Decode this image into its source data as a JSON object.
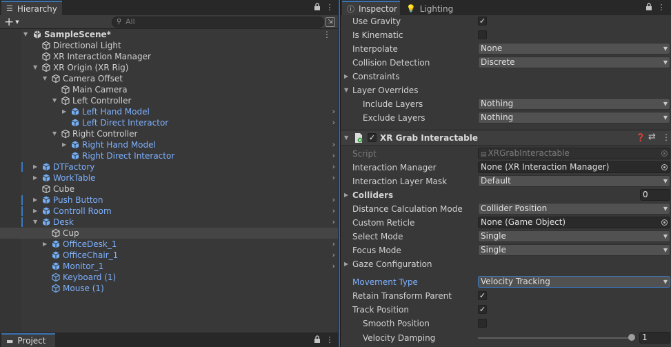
{
  "hierarchy": {
    "tab_label": "Hierarchy",
    "search_placeholder": "All",
    "scene_name": "SampleScene*",
    "items": [
      {
        "label": "Directional Light"
      },
      {
        "label": "XR Interaction Manager"
      },
      {
        "label": "XR Origin (XR Rig)"
      },
      {
        "label": "Camera Offset"
      },
      {
        "label": "Main Camera"
      },
      {
        "label": "Left Controller"
      },
      {
        "label": "Left Hand Model"
      },
      {
        "label": "Left Direct Interactor"
      },
      {
        "label": "Right Controller"
      },
      {
        "label": "Right Hand Model"
      },
      {
        "label": "Right Direct Interactor"
      },
      {
        "label": "DTFactory"
      },
      {
        "label": "WorkTable"
      },
      {
        "label": "Cube"
      },
      {
        "label": "Push Button"
      },
      {
        "label": "Controll Room"
      },
      {
        "label": "Desk"
      },
      {
        "label": "Cup"
      },
      {
        "label": "OfficeDesk_1"
      },
      {
        "label": "OfficeChair_1"
      },
      {
        "label": "Monitor_1"
      },
      {
        "label": "Keyboard (1)"
      },
      {
        "label": "Mouse (1)"
      }
    ]
  },
  "project": {
    "tab_label": "Project"
  },
  "inspector": {
    "tabs": [
      {
        "label": "Inspector"
      },
      {
        "label": "Lighting"
      }
    ],
    "rigidbody": {
      "use_gravity": {
        "label": "Use Gravity",
        "checked": true
      },
      "is_kinematic": {
        "label": "Is Kinematic",
        "checked": false
      },
      "interpolate": {
        "label": "Interpolate",
        "value": "None"
      },
      "collision_detection": {
        "label": "Collision Detection",
        "value": "Discrete"
      },
      "constraints": {
        "label": "Constraints"
      },
      "layer_overrides": {
        "label": "Layer Overrides"
      },
      "include_layers": {
        "label": "Include Layers",
        "value": "Nothing"
      },
      "exclude_layers": {
        "label": "Exclude Layers",
        "value": "Nothing"
      }
    },
    "grab": {
      "title": "XR Grab Interactable",
      "enabled": true,
      "script": {
        "label": "Script",
        "value": "XRGrabInteractable"
      },
      "interaction_manager": {
        "label": "Interaction Manager",
        "value": "None (XR Interaction Manager)"
      },
      "interaction_layer_mask": {
        "label": "Interaction Layer Mask",
        "value": "Default"
      },
      "colliders": {
        "label": "Colliders",
        "value": "0"
      },
      "distance_calc": {
        "label": "Distance Calculation Mode",
        "value": "Collider Position"
      },
      "custom_reticle": {
        "label": "Custom Reticle",
        "value": "None (Game Object)"
      },
      "select_mode": {
        "label": "Select Mode",
        "value": "Single"
      },
      "focus_mode": {
        "label": "Focus Mode",
        "value": "Single"
      },
      "gaze_config": {
        "label": "Gaze Configuration"
      },
      "movement_type": {
        "label": "Movement Type",
        "value": "Velocity Tracking"
      },
      "retain_transform_parent": {
        "label": "Retain Transform Parent",
        "checked": true
      },
      "track_position": {
        "label": "Track Position",
        "checked": true
      },
      "smooth_position": {
        "label": "Smooth Position",
        "checked": false
      },
      "velocity_damping": {
        "label": "Velocity Damping",
        "value": "1",
        "slider_fraction": 1.0
      }
    }
  },
  "colors": {
    "accent": "#3a79c2",
    "prefab_text": "#7eb1ff",
    "panel_bg": "#383838"
  }
}
